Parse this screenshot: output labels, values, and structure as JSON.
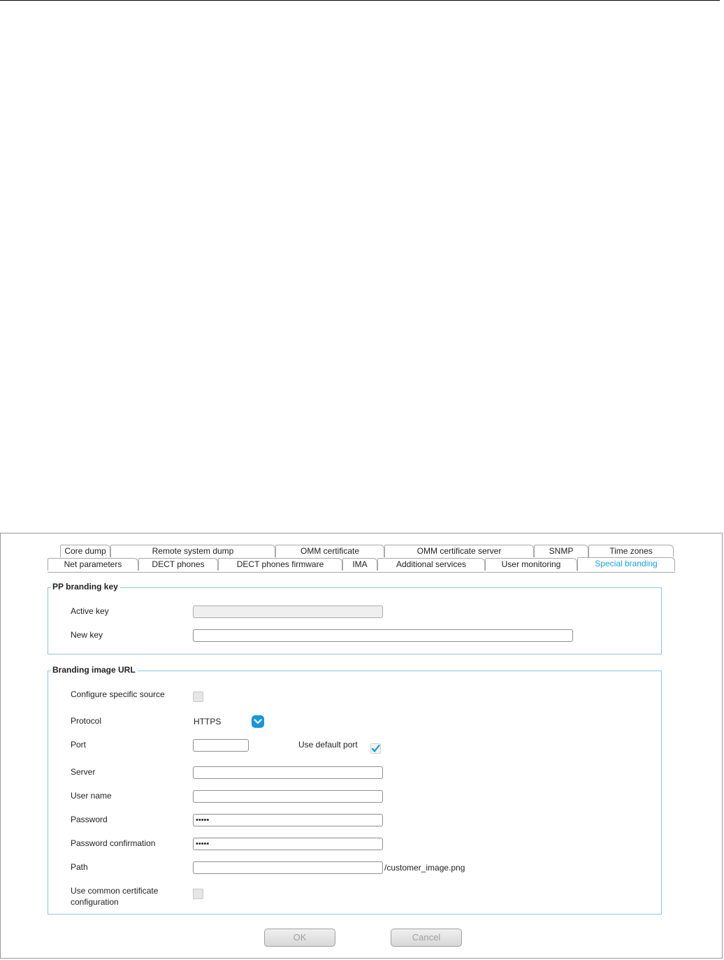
{
  "tabs": {
    "row1": [
      "Core dump",
      "Remote system dump",
      "OMM certificate",
      "OMM certificate server",
      "SNMP",
      "Time zones"
    ],
    "row2": [
      "Net parameters",
      "DECT phones",
      "DECT phones firmware",
      "IMA",
      "Additional services",
      "User monitoring",
      "Special branding"
    ]
  },
  "pp_branding_key": {
    "legend": "PP branding key",
    "active_key_label": "Active key",
    "active_key_value": "",
    "new_key_label": "New key",
    "new_key_value": ""
  },
  "branding_image_url": {
    "legend": "Branding image URL",
    "configure_source_label": "Configure specific source",
    "protocol_label": "Protocol",
    "protocol_value": "HTTPS",
    "port_label": "Port",
    "port_value": "",
    "use_default_port_label": "Use default port",
    "server_label": "Server",
    "server_value": "",
    "user_name_label": "User name",
    "user_name_value": "",
    "password_label": "Password",
    "password_value": "•••••",
    "password_confirm_label": "Password confirmation",
    "password_confirm_value": "•••••",
    "path_label": "Path",
    "path_value": "",
    "path_suffix": "/customer_image.png",
    "common_cert_label_line1": "Use common certificate",
    "common_cert_label_line2": "configuration"
  },
  "buttons": {
    "ok": "OK",
    "cancel": "Cancel"
  },
  "colors": {
    "accent": "#1aa0d8",
    "group_border": "#8fc3e6",
    "select_button": "#1a97d6"
  }
}
